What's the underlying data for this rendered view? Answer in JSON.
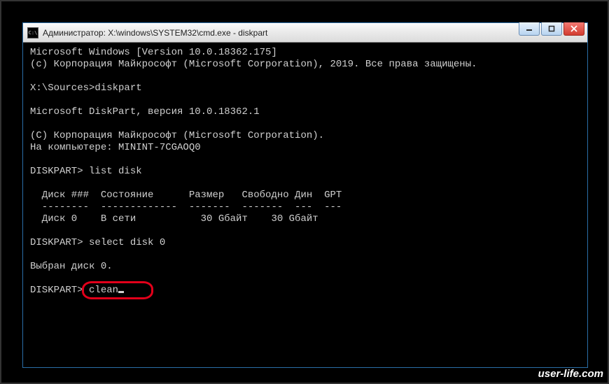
{
  "window": {
    "title": "Администратор: X:\\windows\\SYSTEM32\\cmd.exe - diskpart",
    "icon_glyph": "C:\\"
  },
  "terminal": {
    "lines": [
      "Microsoft Windows [Version 10.0.18362.175]",
      "(c) Корпорация Майкрософт (Microsoft Corporation), 2019. Все права защищены.",
      "",
      "X:\\Sources>diskpart",
      "",
      "Microsoft DiskPart, версия 10.0.18362.1",
      "",
      "(C) Корпорация Майкрософт (Microsoft Corporation).",
      "На компьютере: MININT-7CGAOQ0",
      "",
      "DISKPART> list disk",
      "",
      "  Диск ###  Состояние      Размер   Свободно Дин  GPT",
      "  --------  -------------  -------  -------  ---  ---",
      "  Диск 0    В сети           30 Gбайт    30 Gбайт",
      "",
      "DISKPART> select disk 0",
      "",
      "Выбран диск 0.",
      ""
    ],
    "final_prompt": "DISKPART> ",
    "final_command": "clean"
  },
  "highlight": {
    "target": "clean"
  },
  "watermark": "user-life.com"
}
